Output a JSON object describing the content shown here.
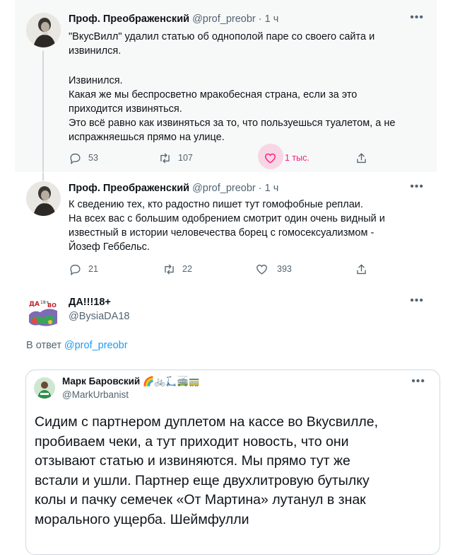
{
  "tweet1": {
    "name": "Проф. Преображенский",
    "handle": "@prof_preobr",
    "time": "· 1 ч",
    "lines": [
      "\"ВкусВилл\" удалил статью об однополой паре со своего сайта и",
      "извинился.",
      "",
      "Извинился.",
      "Какая же мы беспросветно мракобесная страна, если за это",
      "приходится извиняться.",
      "Это всё равно как извиняться за то, что пользуешься туалетом, а не",
      "испражняешься прямо на улице."
    ],
    "replies": "53",
    "retweets": "107",
    "likes": "1 тыс."
  },
  "tweet2": {
    "name": "Проф. Преображенский",
    "handle": "@prof_preobr",
    "time": "· 1 ч",
    "lines": [
      "К сведению тех, кто радостно пишет тут гомофобные реплаи.",
      "На всех вас с большим одобрением смотрит один очень видный и",
      "известный в истории человечества борец с гомосексуализмом -",
      "Йозеф Геббельс."
    ],
    "replies": "21",
    "retweets": "22",
    "likes": "393"
  },
  "tweet3": {
    "name": "ДА!!!18+",
    "handle": "@BysiaDA18",
    "reply_prefix": "В ответ",
    "reply_to": "@prof_preobr",
    "avatar_text": "ДА 18+ ВО"
  },
  "quote": {
    "name": "Марк Баровский",
    "emojis": "🌈🚲🛴🚎🚃",
    "handle": "@MarkUrbanist",
    "lines": [
      "Сидим с партнером дуплетом на кассе во Вкусвилле,",
      "пробиваем чеки, а тут приходит новость, что они",
      "отзывают статью и извиняются. Мы прямо тут же",
      "встали и ушли. Партнер еще двухлитровую бутылку",
      "колы и пачку семечек «От Мартина» лутанул в знак",
      "морального ущерба. Шеймфулли"
    ]
  },
  "colors": {
    "accent": "#1d9bf0",
    "like": "#f91880",
    "muted": "#536471"
  },
  "icons": [
    "reply-icon",
    "retweet-icon",
    "like-icon",
    "share-icon",
    "more-icon"
  ]
}
